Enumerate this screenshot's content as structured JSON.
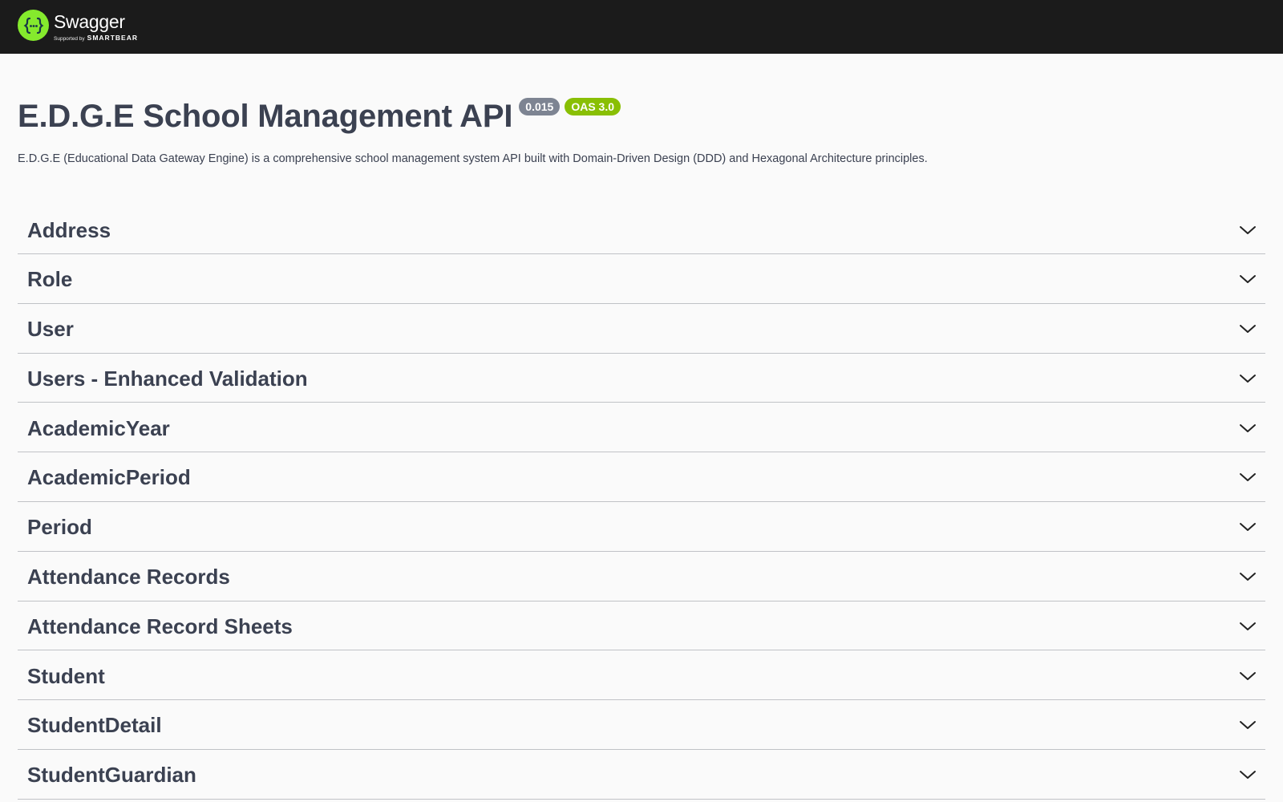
{
  "topbar": {
    "brand_name": "Swagger",
    "brand_sub_prefix": "Supported by",
    "brand_sub_company": "SMARTBEAR",
    "logo_icon": "swagger-braces-icon",
    "logo_color": "#85ea2d",
    "background": "#1b1b1b"
  },
  "info": {
    "title": "E.D.G.E School Management API",
    "version": "0.015",
    "oas": "OAS 3.0",
    "description": "E.D.G.E (Educational Data Gateway Engine) is a comprehensive school management system API built with Domain-Driven Design (DDD) and Hexagonal Architecture principles."
  },
  "colors": {
    "version_badge": "#7d8492",
    "oas_badge": "#89bf04",
    "text": "#3b4151"
  },
  "tags": [
    {
      "name": "Address",
      "icon": "chevron-down-icon"
    },
    {
      "name": "Role",
      "icon": "chevron-down-icon"
    },
    {
      "name": "User",
      "icon": "chevron-down-icon"
    },
    {
      "name": "Users - Enhanced Validation",
      "icon": "chevron-down-icon"
    },
    {
      "name": "AcademicYear",
      "icon": "chevron-down-icon"
    },
    {
      "name": "AcademicPeriod",
      "icon": "chevron-down-icon"
    },
    {
      "name": "Period",
      "icon": "chevron-down-icon"
    },
    {
      "name": "Attendance Records",
      "icon": "chevron-down-icon"
    },
    {
      "name": "Attendance Record Sheets",
      "icon": "chevron-down-icon"
    },
    {
      "name": "Student",
      "icon": "chevron-down-icon"
    },
    {
      "name": "StudentDetail",
      "icon": "chevron-down-icon"
    },
    {
      "name": "StudentGuardian",
      "icon": "chevron-down-icon"
    }
  ]
}
